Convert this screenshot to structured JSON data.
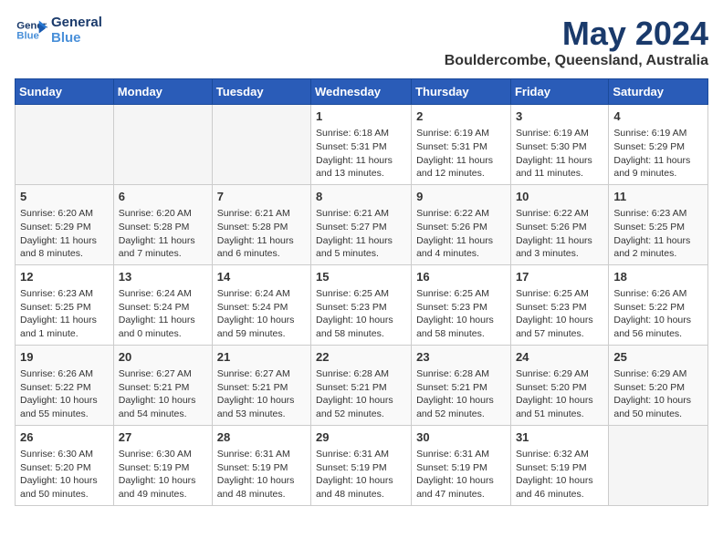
{
  "header": {
    "logo_line1": "General",
    "logo_line2": "Blue",
    "month_year": "May 2024",
    "location": "Bouldercombe, Queensland, Australia"
  },
  "weekdays": [
    "Sunday",
    "Monday",
    "Tuesday",
    "Wednesday",
    "Thursday",
    "Friday",
    "Saturday"
  ],
  "weeks": [
    [
      {
        "day": "",
        "info": ""
      },
      {
        "day": "",
        "info": ""
      },
      {
        "day": "",
        "info": ""
      },
      {
        "day": "1",
        "info": "Sunrise: 6:18 AM\nSunset: 5:31 PM\nDaylight: 11 hours and 13 minutes."
      },
      {
        "day": "2",
        "info": "Sunrise: 6:19 AM\nSunset: 5:31 PM\nDaylight: 11 hours and 12 minutes."
      },
      {
        "day": "3",
        "info": "Sunrise: 6:19 AM\nSunset: 5:30 PM\nDaylight: 11 hours and 11 minutes."
      },
      {
        "day": "4",
        "info": "Sunrise: 6:19 AM\nSunset: 5:29 PM\nDaylight: 11 hours and 9 minutes."
      }
    ],
    [
      {
        "day": "5",
        "info": "Sunrise: 6:20 AM\nSunset: 5:29 PM\nDaylight: 11 hours and 8 minutes."
      },
      {
        "day": "6",
        "info": "Sunrise: 6:20 AM\nSunset: 5:28 PM\nDaylight: 11 hours and 7 minutes."
      },
      {
        "day": "7",
        "info": "Sunrise: 6:21 AM\nSunset: 5:28 PM\nDaylight: 11 hours and 6 minutes."
      },
      {
        "day": "8",
        "info": "Sunrise: 6:21 AM\nSunset: 5:27 PM\nDaylight: 11 hours and 5 minutes."
      },
      {
        "day": "9",
        "info": "Sunrise: 6:22 AM\nSunset: 5:26 PM\nDaylight: 11 hours and 4 minutes."
      },
      {
        "day": "10",
        "info": "Sunrise: 6:22 AM\nSunset: 5:26 PM\nDaylight: 11 hours and 3 minutes."
      },
      {
        "day": "11",
        "info": "Sunrise: 6:23 AM\nSunset: 5:25 PM\nDaylight: 11 hours and 2 minutes."
      }
    ],
    [
      {
        "day": "12",
        "info": "Sunrise: 6:23 AM\nSunset: 5:25 PM\nDaylight: 11 hours and 1 minute."
      },
      {
        "day": "13",
        "info": "Sunrise: 6:24 AM\nSunset: 5:24 PM\nDaylight: 11 hours and 0 minutes."
      },
      {
        "day": "14",
        "info": "Sunrise: 6:24 AM\nSunset: 5:24 PM\nDaylight: 10 hours and 59 minutes."
      },
      {
        "day": "15",
        "info": "Sunrise: 6:25 AM\nSunset: 5:23 PM\nDaylight: 10 hours and 58 minutes."
      },
      {
        "day": "16",
        "info": "Sunrise: 6:25 AM\nSunset: 5:23 PM\nDaylight: 10 hours and 58 minutes."
      },
      {
        "day": "17",
        "info": "Sunrise: 6:25 AM\nSunset: 5:23 PM\nDaylight: 10 hours and 57 minutes."
      },
      {
        "day": "18",
        "info": "Sunrise: 6:26 AM\nSunset: 5:22 PM\nDaylight: 10 hours and 56 minutes."
      }
    ],
    [
      {
        "day": "19",
        "info": "Sunrise: 6:26 AM\nSunset: 5:22 PM\nDaylight: 10 hours and 55 minutes."
      },
      {
        "day": "20",
        "info": "Sunrise: 6:27 AM\nSunset: 5:21 PM\nDaylight: 10 hours and 54 minutes."
      },
      {
        "day": "21",
        "info": "Sunrise: 6:27 AM\nSunset: 5:21 PM\nDaylight: 10 hours and 53 minutes."
      },
      {
        "day": "22",
        "info": "Sunrise: 6:28 AM\nSunset: 5:21 PM\nDaylight: 10 hours and 52 minutes."
      },
      {
        "day": "23",
        "info": "Sunrise: 6:28 AM\nSunset: 5:21 PM\nDaylight: 10 hours and 52 minutes."
      },
      {
        "day": "24",
        "info": "Sunrise: 6:29 AM\nSunset: 5:20 PM\nDaylight: 10 hours and 51 minutes."
      },
      {
        "day": "25",
        "info": "Sunrise: 6:29 AM\nSunset: 5:20 PM\nDaylight: 10 hours and 50 minutes."
      }
    ],
    [
      {
        "day": "26",
        "info": "Sunrise: 6:30 AM\nSunset: 5:20 PM\nDaylight: 10 hours and 50 minutes."
      },
      {
        "day": "27",
        "info": "Sunrise: 6:30 AM\nSunset: 5:19 PM\nDaylight: 10 hours and 49 minutes."
      },
      {
        "day": "28",
        "info": "Sunrise: 6:31 AM\nSunset: 5:19 PM\nDaylight: 10 hours and 48 minutes."
      },
      {
        "day": "29",
        "info": "Sunrise: 6:31 AM\nSunset: 5:19 PM\nDaylight: 10 hours and 48 minutes."
      },
      {
        "day": "30",
        "info": "Sunrise: 6:31 AM\nSunset: 5:19 PM\nDaylight: 10 hours and 47 minutes."
      },
      {
        "day": "31",
        "info": "Sunrise: 6:32 AM\nSunset: 5:19 PM\nDaylight: 10 hours and 46 minutes."
      },
      {
        "day": "",
        "info": ""
      }
    ]
  ]
}
